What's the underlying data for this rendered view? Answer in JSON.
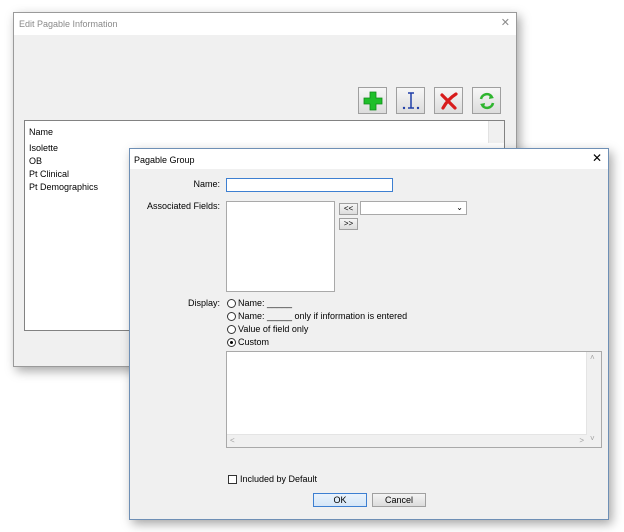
{
  "back_window": {
    "title": "Edit Pagable Information",
    "close_glyph": "✕",
    "toolbar": {
      "add_icon": "plus-icon",
      "insert_icon": "insert-icon",
      "delete_icon": "delete-x-icon",
      "refresh_icon": "refresh-icon"
    },
    "list": {
      "header": "Name",
      "items": [
        "Isolette",
        "OB",
        "Pt Clinical",
        "Pt Demographics"
      ]
    }
  },
  "dialog": {
    "title": "Pagable Group",
    "close_glyph": "✕",
    "name_label": "Name:",
    "name_value": "",
    "associated_label": "Associated Fields:",
    "move_left_label": "<<",
    "move_right_label": ">>",
    "field_select_value": "",
    "display_label": "Display:",
    "display_options": [
      "Name: _____",
      "Name: _____ only if information is entered",
      "Value of field only",
      "Custom"
    ],
    "display_selected": "Custom",
    "custom_text": "",
    "included_label": "Included by Default",
    "included_checked": false,
    "ok_label": "OK",
    "cancel_label": "Cancel"
  },
  "colors": {
    "add_green": "#1fbf2a",
    "insert_blue": "#1f3ea8",
    "delete_red": "#d81c1c",
    "refresh_green": "#2fb52f",
    "focus_blue": "#3d7fd1"
  }
}
